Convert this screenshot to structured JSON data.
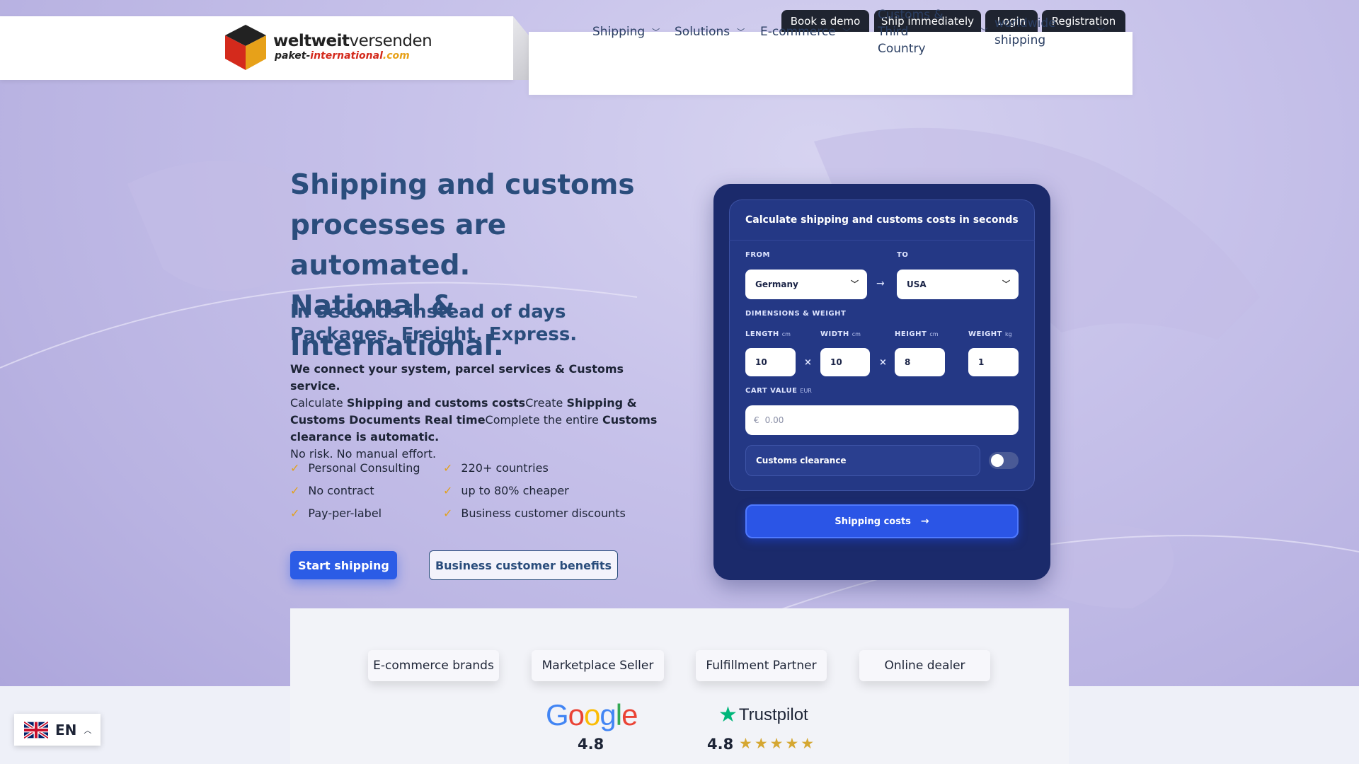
{
  "logo": {
    "line1_bold": "weltweit",
    "line1_light": "versenden",
    "line2_a": "paket-",
    "line2_b": "international",
    "line2_c": ".com"
  },
  "top_buttons": [
    "Book a demo",
    "Ship immediately",
    "Login",
    "Registration"
  ],
  "nav": {
    "items": [
      {
        "label": "Shipping"
      },
      {
        "label": "Solutions"
      },
      {
        "label": "E-commerce"
      },
      {
        "label_line1": "Customs & Third",
        "label_line2": "Country"
      },
      {
        "label_line1": "worldwide",
        "label_line2": "shipping"
      }
    ]
  },
  "hero": {
    "title_line1": "Shipping and customs",
    "title_line2": "processes are automated.",
    "title_line3": "National & International.",
    "sub_line1": "In seconds instead of days",
    "sub_line2": "Packages. Freight. Express.",
    "para_bold1": "We connect your system, parcel services & Customs service.",
    "para_t1": "Calculate ",
    "para_b2": "Shipping and customs costs",
    "para_t2": "Create ",
    "para_b3": "Shipping & Customs Documents Real time",
    "para_t3": "Complete the entire ",
    "para_b4": "Customs clearance is automatic.",
    "para_last": "No risk. No manual effort.",
    "checks_left": [
      "Personal Consulting",
      "No contract",
      "Pay-per-label"
    ],
    "checks_right": [
      "220+ countries",
      "up to 80% cheaper",
      "Business customer discounts"
    ],
    "check_mark": "✓",
    "btn_primary": "Start shipping",
    "btn_outline": "Business customer benefits"
  },
  "calculator": {
    "title": "Calculate shipping and customs costs in seconds",
    "from_label": "FROM",
    "to_label": "TO",
    "from_value": "Germany",
    "to_value": "USA",
    "dims_label": "DIMENSIONS & WEIGHT",
    "length_label": "LENGTH",
    "width_label": "WIDTH",
    "height_label": "HEIGHT",
    "weight_label": "WEIGHT",
    "unit_cm": "cm",
    "unit_kg": "kg",
    "length_value": "10",
    "width_value": "10",
    "height_value": "8",
    "weight_value": "1",
    "times": "×",
    "cart_label": "CART VALUE",
    "cart_unit": "EUR",
    "cart_currency": "€",
    "cart_placeholder": "0.00",
    "customs_label": "Customs clearance",
    "customs_enabled": false,
    "submit_label": "Shipping costs"
  },
  "segments": [
    "E-commerce brands",
    "Marketplace Seller",
    "Fulfillment Partner",
    "Online dealer"
  ],
  "reviews": {
    "google_rating": "4.8",
    "trustpilot_name": "Trustpilot",
    "trustpilot_rating": "4.8",
    "trustpilot_stars": "★★★★★"
  },
  "language": {
    "code": "EN"
  },
  "colors": {
    "primary_blue": "#2b5ce6",
    "card_navy": "#1b2a6b",
    "heading_blue": "#2a4d7c",
    "check_gold": "#e2a11d"
  }
}
